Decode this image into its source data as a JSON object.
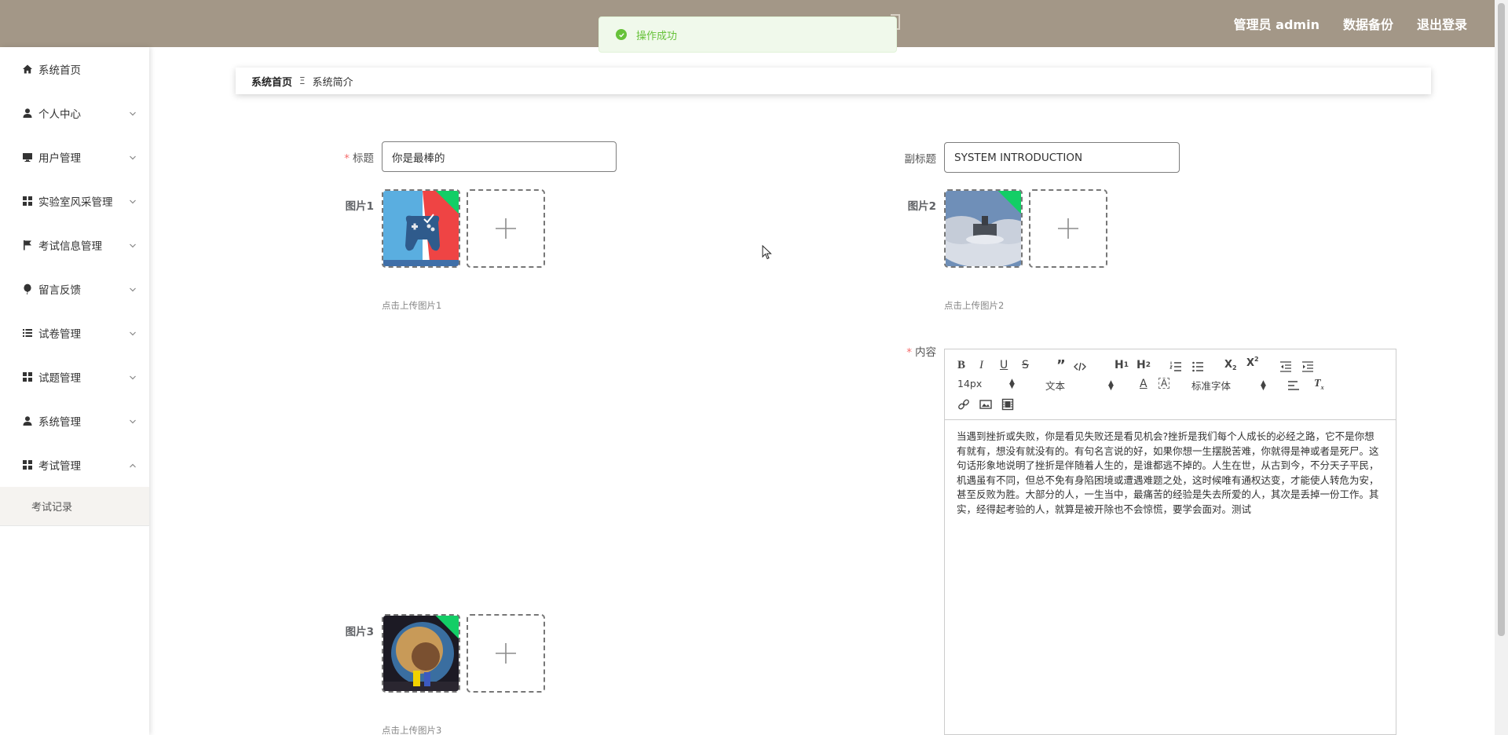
{
  "topbar": {
    "admin_label": "管理员 admin",
    "backup_label": "数据备份",
    "logout_label": "退出登录"
  },
  "toast": {
    "message": "操作成功",
    "status_color": "#67c23a"
  },
  "sidebar": {
    "items": [
      {
        "label": "系统首页",
        "icon": "home-icon",
        "expandable": false
      },
      {
        "label": "个人中心",
        "icon": "user-icon",
        "expandable": true
      },
      {
        "label": "用户管理",
        "icon": "monitor-icon",
        "expandable": true
      },
      {
        "label": "实验室风采管理",
        "icon": "grid-icon",
        "expandable": true
      },
      {
        "label": "考试信息管理",
        "icon": "flag-icon",
        "expandable": true
      },
      {
        "label": "留言反馈",
        "icon": "balloon-icon",
        "expandable": true
      },
      {
        "label": "试卷管理",
        "icon": "list-icon",
        "expandable": true
      },
      {
        "label": "试题管理",
        "icon": "grid-icon",
        "expandable": true
      },
      {
        "label": "系统管理",
        "icon": "user-icon",
        "expandable": true
      },
      {
        "label": "考试管理",
        "icon": "grid-icon",
        "expandable": true,
        "expanded": true
      }
    ],
    "submenu": {
      "label": "考试记录"
    }
  },
  "breadcrumb": {
    "home": "系统首页",
    "separator": "Ξ",
    "current": "系统简介"
  },
  "form": {
    "title_label": "标题",
    "title_value": "你是最棒的",
    "subtitle_label": "副标题",
    "subtitle_value": "SYSTEM INTRODUCTION",
    "image1_label": "图片1",
    "image1_tip": "点击上传图片1",
    "image2_label": "图片2",
    "image2_tip": "点击上传图片2",
    "image3_label": "图片3",
    "image3_tip": "点击上传图片3",
    "content_label": "内容"
  },
  "editor": {
    "font_size": "14px",
    "header_select": "文本",
    "font_family": "标准字体",
    "content": "当遇到挫折或失败，你是看见失败还是看见机会?挫折是我们每个人成长的必经之路，它不是你想有就有，想没有就没有的。有句名言说的好，如果你想一生摆脱苦难，你就得是神或者是死尸。这句话形象地说明了挫折是伴随着人生的，是谁都逃不掉的。人生在世，从古到今，不分天子平民，机遇虽有不同，但总不免有身陷困境或遭遇难题之处，这时候唯有通权达变，才能使人转危为安，甚至反败为胜。大部分的人，一生当中，最痛苦的经验是失去所爱的人，其次是丢掉一份工作。其实，经得起考验的人，就算是被开除也不会惊慌，要学会面对。测试"
  },
  "colors": {
    "topbar": "#a39787",
    "success": "#67c23a",
    "upload_badge": "#13ce66",
    "required": "#f56c6c"
  }
}
